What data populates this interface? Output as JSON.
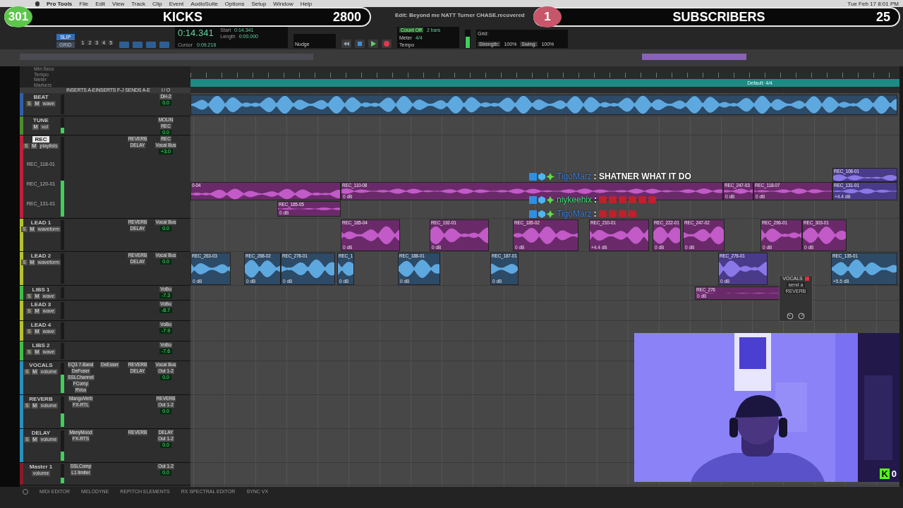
{
  "menubar": {
    "app": "Pro Tools",
    "items": [
      "File",
      "Edit",
      "View",
      "Track",
      "Clip",
      "Event",
      "AudioSuite",
      "Options",
      "Setup",
      "Window",
      "Help"
    ],
    "clock": "Tue Feb 17  8:01 PM"
  },
  "window": {
    "title": "Edit: Beyond me NATT Turner CHASE.recovered"
  },
  "overlay_left": {
    "count": "301",
    "label": "KICKS",
    "value": "2800"
  },
  "overlay_right": {
    "count": "1",
    "label": "SUBSCRIBERS",
    "value": "25"
  },
  "toolbar": {
    "modes": [
      {
        "label": "SLIP",
        "selected": true
      },
      {
        "label": "GRID",
        "selected": false
      }
    ],
    "zoom_presets": [
      "1",
      "2",
      "3",
      "4",
      "5"
    ],
    "counter": "0:14.341",
    "fields": [
      {
        "label": "Start",
        "value": "0:14.341"
      },
      {
        "label": "Length",
        "value": "0:00.000"
      }
    ],
    "cursor_label": "Cursor",
    "cursor": "0:09.216",
    "count_off": "Count Off",
    "meter": "Meter",
    "tempo": "Tempo",
    "bars": "2 bars",
    "signature": "4/4",
    "nudge": "Nudge",
    "grid": "Grid:",
    "strength": "Strength:",
    "strength_value": "100%",
    "swing": "Swing:",
    "swing_value": "100%"
  },
  "rulers": [
    "Min:Secs",
    "Tempo",
    "Meter",
    "Markers"
  ],
  "meter_ruler": "Default: 4/4",
  "columns": [
    "INSERTS A-E",
    "INSERTS F-J",
    "SENDS A-E",
    "I / O"
  ],
  "tracks": [
    {
      "name": "BEAT",
      "selected": false,
      "buttons": [
        {
          "kind": "solo",
          "label": "S"
        },
        {
          "kind": "mute",
          "label": "M"
        }
      ],
      "view": "wave",
      "io": [
        "DH-2"
      ],
      "vol": "0.0",
      "level": 0,
      "clips": [
        {
          "kind": "audio"
        }
      ]
    },
    {
      "name": "TUNE",
      "selected": false,
      "buttons": [
        {
          "kind": "mute",
          "label": "M"
        }
      ],
      "view": "vol",
      "io": [
        "MOLIN",
        "REC"
      ],
      "vol": "0.0",
      "level": 0.35
    },
    {
      "name": "REC",
      "selected": true,
      "buttons": [
        {
          "kind": "solo",
          "label": "S"
        },
        {
          "kind": "mute",
          "label": "M"
        }
      ],
      "view": "playlists",
      "sends": [
        "REVERB",
        "DELAY"
      ],
      "io": [
        "REC",
        "Vocal Bus"
      ],
      "vol": "+3.0",
      "level": 0.45,
      "playlists": [
        "REC_118-01",
        "REC_120-01",
        "REC_131-01"
      ],
      "clips": [
        {
          "kind": "audio",
          "name": "0-04"
        },
        {
          "kind": "audio",
          "name": "REC_110-08",
          "gain": "0 dB"
        },
        {
          "kind": "audio",
          "name": "REC_247-03",
          "gain": "0 dB"
        },
        {
          "kind": "audio",
          "name": "REC_118-07",
          "gain": "0 dB"
        },
        {
          "kind": "audio",
          "name": "REC_108-01"
        },
        {
          "kind": "audio",
          "name": "REC_131-01",
          "gain": "+4.4 dB"
        },
        {
          "kind": "audio",
          "name": "REC_165-05",
          "gain": "0 dB"
        }
      ]
    },
    {
      "name": "LEAD 1",
      "selected": false,
      "buttons": [
        {
          "kind": "solo",
          "label": "S"
        },
        {
          "kind": "mute",
          "label": "M"
        }
      ],
      "view": "waveform",
      "sends": [
        "REVERB",
        "DELAY"
      ],
      "io": [
        "Vocal Bus"
      ],
      "vol": "0.0",
      "level": 0,
      "clips": [
        {
          "kind": "audio",
          "name": "REC_185-04",
          "gain": "0 dB"
        },
        {
          "kind": "audio",
          "name": "REC_192-01",
          "gain": "0 dB"
        },
        {
          "kind": "audio",
          "name": "REC_185-02",
          "gain": "0 dB"
        },
        {
          "kind": "audio",
          "name": "REC_210-01",
          "gain": "+4.4 dB"
        },
        {
          "kind": "audio",
          "name": "REC_222-01",
          "gain": "0 dB"
        },
        {
          "kind": "audio",
          "name": "REC_247-02",
          "gain": "0 dB"
        },
        {
          "kind": "audio",
          "name": "REC_296-01",
          "gain": "0 dB"
        },
        {
          "kind": "audio",
          "name": "REC_303-01",
          "gain": "0 dB"
        }
      ]
    },
    {
      "name": "LEAD 2",
      "selected": false,
      "buttons": [
        {
          "kind": "solo",
          "label": "S"
        },
        {
          "kind": "mute",
          "label": "M"
        }
      ],
      "view": "waveform",
      "sends": [
        "REVERB",
        "DELAY"
      ],
      "io": [
        "Vocal Bus"
      ],
      "vol": "0.0",
      "level": 0,
      "clips": [
        {
          "kind": "audio",
          "name": "REC_263-03",
          "gain": "0 dB"
        },
        {
          "kind": "audio",
          "name": "REC_268-02",
          "gain": "0 dB"
        },
        {
          "kind": "audio",
          "name": "REC_278-01",
          "gain": "0 dB"
        },
        {
          "kind": "audio",
          "name": "REC_1",
          "gain": "0 dB"
        },
        {
          "kind": "audio",
          "name": "REC_188-01",
          "gain": "0 dB"
        },
        {
          "kind": "audio",
          "name": "REC_187-01",
          "gain": "0 dB"
        },
        {
          "kind": "audio",
          "name": "REC_276-01",
          "gain": "0 dB"
        },
        {
          "kind": "audio",
          "name": "REC_135-01",
          "gain": "+5.5 dB"
        }
      ]
    },
    {
      "name": "LIBS 1",
      "selected": false,
      "buttons": [
        {
          "kind": "solo",
          "label": "S"
        },
        {
          "kind": "mute",
          "label": "M"
        }
      ],
      "view": "wave",
      "io": [
        "VoBu"
      ],
      "vol": "-7.3",
      "level": 0,
      "clips": [
        {
          "kind": "audio",
          "name": "REC_276",
          "gain": "0 dB"
        }
      ]
    },
    {
      "name": "LEAD 3",
      "selected": false,
      "buttons": [
        {
          "kind": "solo",
          "label": "S"
        },
        {
          "kind": "mute",
          "label": "M"
        }
      ],
      "view": "wave",
      "io": [
        "VoBu"
      ],
      "vol": "-8.7",
      "level": 0
    },
    {
      "name": "LEAD 4",
      "selected": false,
      "buttons": [
        {
          "kind": "solo",
          "label": "S"
        },
        {
          "kind": "mute",
          "label": "M"
        }
      ],
      "view": "wave",
      "io": [
        "VoBu"
      ],
      "vol": "-7.9",
      "level": 0
    },
    {
      "name": "LIBS 2",
      "selected": false,
      "buttons": [
        {
          "kind": "solo",
          "label": "S"
        },
        {
          "kind": "mute",
          "label": "M"
        }
      ],
      "view": "wave",
      "io": [
        "VoBu"
      ],
      "vol": "-7.6",
      "level": 0
    },
    {
      "name": "VOCALS",
      "selected": false,
      "buttons": [
        {
          "kind": "solo",
          "label": "S"
        },
        {
          "kind": "mute",
          "label": "M"
        }
      ],
      "view": "volume",
      "inserts": [
        "EQ3 7-Band",
        "DeFuser",
        "SSLChannel",
        "FComp",
        "RVox"
      ],
      "inserts_fj": [
        "DeEsser"
      ],
      "sends": [
        "REVERB",
        "DELAY"
      ],
      "io": [
        "Vocal Bus",
        "Out 1-2"
      ],
      "vol": "0.0",
      "level": 0.6
    },
    {
      "name": "REVERB",
      "selected": false,
      "buttons": [
        {
          "kind": "solo",
          "label": "S"
        },
        {
          "kind": "mute",
          "label": "M"
        }
      ],
      "view": "volume",
      "inserts": [
        "MangoVerb",
        "FX-RTL"
      ],
      "io": [
        "REVERB",
        "Out 1-2"
      ],
      "vol": "0.0",
      "level": 0.45
    },
    {
      "name": "DELAY",
      "selected": false,
      "buttons": [
        {
          "kind": "solo",
          "label": "S"
        },
        {
          "kind": "mute",
          "label": "M"
        }
      ],
      "view": "volume",
      "inserts": [
        "ManyMood",
        "FX-RTS"
      ],
      "sends": [
        "REVERB"
      ],
      "io": [
        "DELAY",
        "Out 1-2"
      ],
      "vol": "0.0",
      "level": 0.3
    },
    {
      "name": "Master 1",
      "selected": false,
      "view": "volume",
      "inserts": [
        "SSLComp",
        "L1 limiter"
      ],
      "io": [
        "Out 1-2"
      ],
      "vol": "0.0",
      "level": 0.3
    }
  ],
  "chat": [
    {
      "user": "TigoMarz",
      "color": "#3b7fe0",
      "message": ": SHATNER WHAT IT DO"
    },
    {
      "user": "niykeehix",
      "color": "#3fe07a",
      "message": ":"
    },
    {
      "user": "TigoMarz",
      "color": "#3b7fe0",
      "message": ":"
    }
  ],
  "mini_window": {
    "title": "VOCALS",
    "items": [
      "send a",
      "REVERB"
    ]
  },
  "webcam": {
    "kind": "picture",
    "badge": "K",
    "viewers": "0"
  },
  "bottom_tabs": [
    "MIDI EDITOR",
    "MELODYNE",
    "REPITCH ELEMENTS",
    "RX SPECTRAL EDITOR",
    "SYNC VX"
  ]
}
